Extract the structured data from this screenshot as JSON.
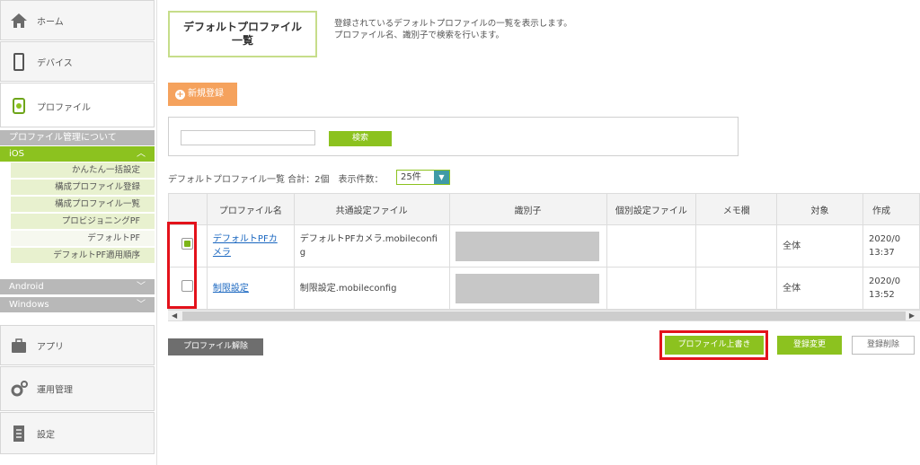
{
  "sidebar": {
    "home": "ホーム",
    "device": "デバイス",
    "profile": "プロファイル",
    "profile_admin": "プロファイル管理について",
    "ios": "iOS",
    "ios_items": [
      "かんたん一括設定",
      "構成プロファイル登録",
      "構成プロファイル一覧",
      "プロビジョニングPF",
      "デフォルトPF",
      "デフォルトPF適用順序"
    ],
    "android": "Android",
    "windows": "Windows",
    "apps": "アプリ",
    "operations": "運用管理",
    "settings": "設定"
  },
  "page": {
    "title_line1": "デフォルトプロファイル",
    "title_line2": "一覧",
    "desc_line1": "登録されているデフォルトプロファイルの一覧を表示します。",
    "desc_line2": "プロファイル名、識別子で検索を行います。",
    "new_button": "新規登録",
    "search_value": "",
    "search_button": "検索",
    "summary": "デフォルトプロファイル一覧 合計：2個　表示件数：",
    "per_page": "25件"
  },
  "table": {
    "headers": [
      "",
      "プロファイル名",
      "共通設定ファイル",
      "識別子",
      "個別設定ファイル",
      "メモ欄",
      "対象",
      "作成"
    ],
    "rows": [
      {
        "checked": true,
        "name_line1": "デフォルトPFカ",
        "name_line2": "メラ",
        "common_line1": "デフォルトPFカメラ.mobileconfi",
        "common_line2": "g",
        "individual": "",
        "memo": "",
        "target": "全体",
        "created_line1": "2020/0",
        "created_line2": "13:37"
      },
      {
        "checked": false,
        "name_line1": "制限設定",
        "name_line2": "",
        "common_line1": "制限設定.mobileconfig",
        "common_line2": "",
        "individual": "",
        "memo": "",
        "target": "全体",
        "created_line1": "2020/0",
        "created_line2": "13:52"
      }
    ]
  },
  "actions": {
    "unassign": "プロファイル解除",
    "overwrite": "プロファイル上書き",
    "change": "登録変更",
    "delete": "登録削除"
  },
  "colors": {
    "accent": "#8cc21f",
    "new": "#f5a25d",
    "highlight": "#e3121b"
  }
}
